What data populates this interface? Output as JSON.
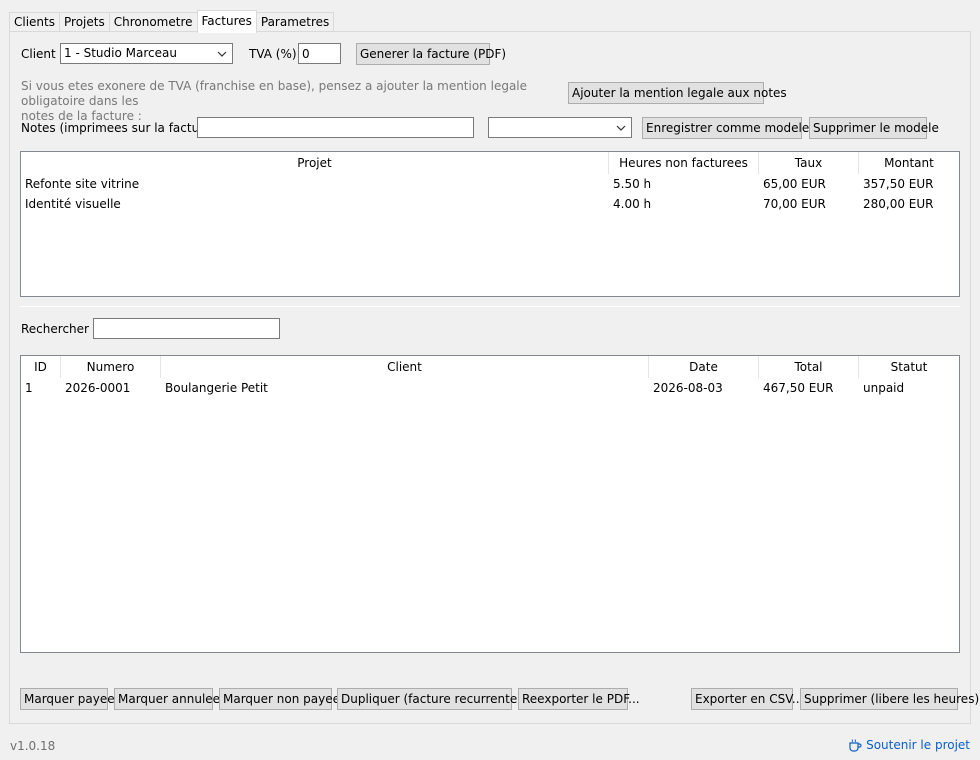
{
  "tabs": [
    "Clients",
    "Projets",
    "Chronometre",
    "Factures",
    "Parametres"
  ],
  "active_tab_index": 3,
  "invoice_form": {
    "client_label": "Client",
    "client_value": "1 - Studio Marceau",
    "tva_label": "TVA (%)",
    "tva_value": "0",
    "generate_button": "Generer la facture (PDF)",
    "exemption_note_line1": "Si vous etes exonere de TVA (franchise en base), pensez a ajouter la mention legale obligatoire dans les",
    "exemption_note_line2": "notes de la facture :",
    "add_legal_button": "Ajouter la mention legale aux notes",
    "notes_label": "Notes (imprimees sur la facture)",
    "notes_value": "",
    "template_select_value": "",
    "save_template_button": "Enregistrer comme modele...",
    "delete_template_button": "Supprimer le modele"
  },
  "projects_table": {
    "columns": [
      "Projet",
      "Heures non facturees",
      "Taux",
      "Montant"
    ],
    "rows": [
      [
        "Refonte site vitrine",
        "5.50 h",
        "65,00 EUR",
        "357,50 EUR"
      ],
      [
        "Identité visuelle",
        "4.00 h",
        "70,00 EUR",
        "280,00 EUR"
      ]
    ]
  },
  "search": {
    "label": "Rechercher :",
    "value": ""
  },
  "invoices_table": {
    "columns": [
      "ID",
      "Numero",
      "Client",
      "Date",
      "Total",
      "Statut"
    ],
    "rows": [
      [
        "1",
        "2026-0001",
        "Boulangerie Petit",
        "2026-08-03",
        "467,50 EUR",
        "unpaid"
      ]
    ]
  },
  "actions": {
    "mark_paid": "Marquer payee",
    "mark_cancelled": "Marquer annulee",
    "mark_unpaid": "Marquer non payee",
    "duplicate": "Dupliquer (facture recurrente)...",
    "reexport_pdf": "Reexporter le PDF...",
    "export_csv": "Exporter en CSV...",
    "delete": "Supprimer (libere les heures)"
  },
  "footer": {
    "version": "v1.0.18",
    "support_link": "Soutenir le projet",
    "support_icon": "cup-icon"
  },
  "colors": {
    "link": "#0b5fc6",
    "muted_text": "#787878"
  }
}
